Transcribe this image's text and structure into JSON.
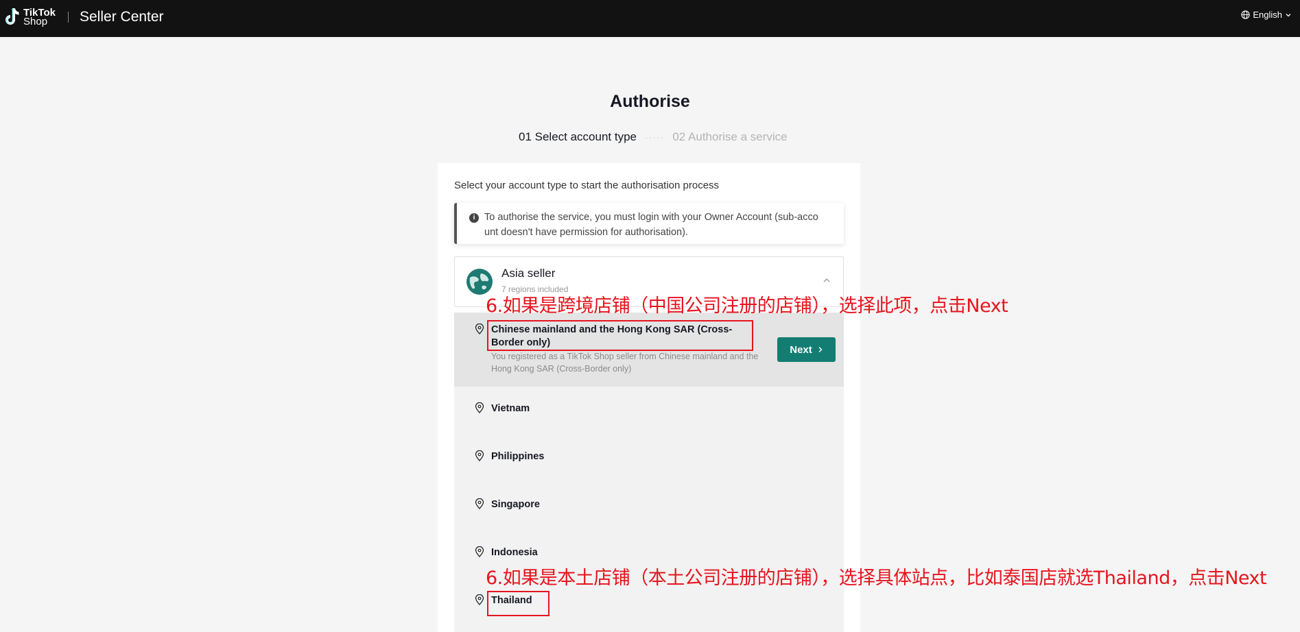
{
  "header": {
    "logo_line1": "TikTok",
    "logo_line2": "Shop",
    "title": "Seller Center",
    "language": "English"
  },
  "page": {
    "title": "Authorise",
    "step1": "01 Select account type",
    "step_separator": "·····",
    "step2": "02 Authorise a service"
  },
  "card": {
    "hint": "Select your account type to start the authorisation process",
    "notice": "To authorise the service, you must login with your Owner Account (sub-acco unt doesn't have permission for authorisation).",
    "seller": {
      "name": "Asia seller",
      "sub": "7 regions included"
    },
    "regions": [
      {
        "name": "Chinese mainland and the Hong Kong SAR (Cross-Border only)",
        "desc": "You registered as a TikTok Shop seller from Chinese mainland and the Hong Kong SAR (Cross-Border only)",
        "selected": true
      },
      {
        "name": "Vietnam"
      },
      {
        "name": "Philippines"
      },
      {
        "name": "Singapore"
      },
      {
        "name": "Indonesia"
      },
      {
        "name": "Thailand"
      }
    ],
    "next_label": "Next"
  },
  "annotations": {
    "cross_border": "6.如果是跨境店铺（中国公司注册的店铺），选择此项，点击Next",
    "local": "6.如果是本土店铺（本土公司注册的店铺），选择具体站点，比如泰国店就选Thailand，点击Next"
  },
  "colors": {
    "topbar": "#121212",
    "accent": "#137d73",
    "annotation": "#e6141e"
  }
}
